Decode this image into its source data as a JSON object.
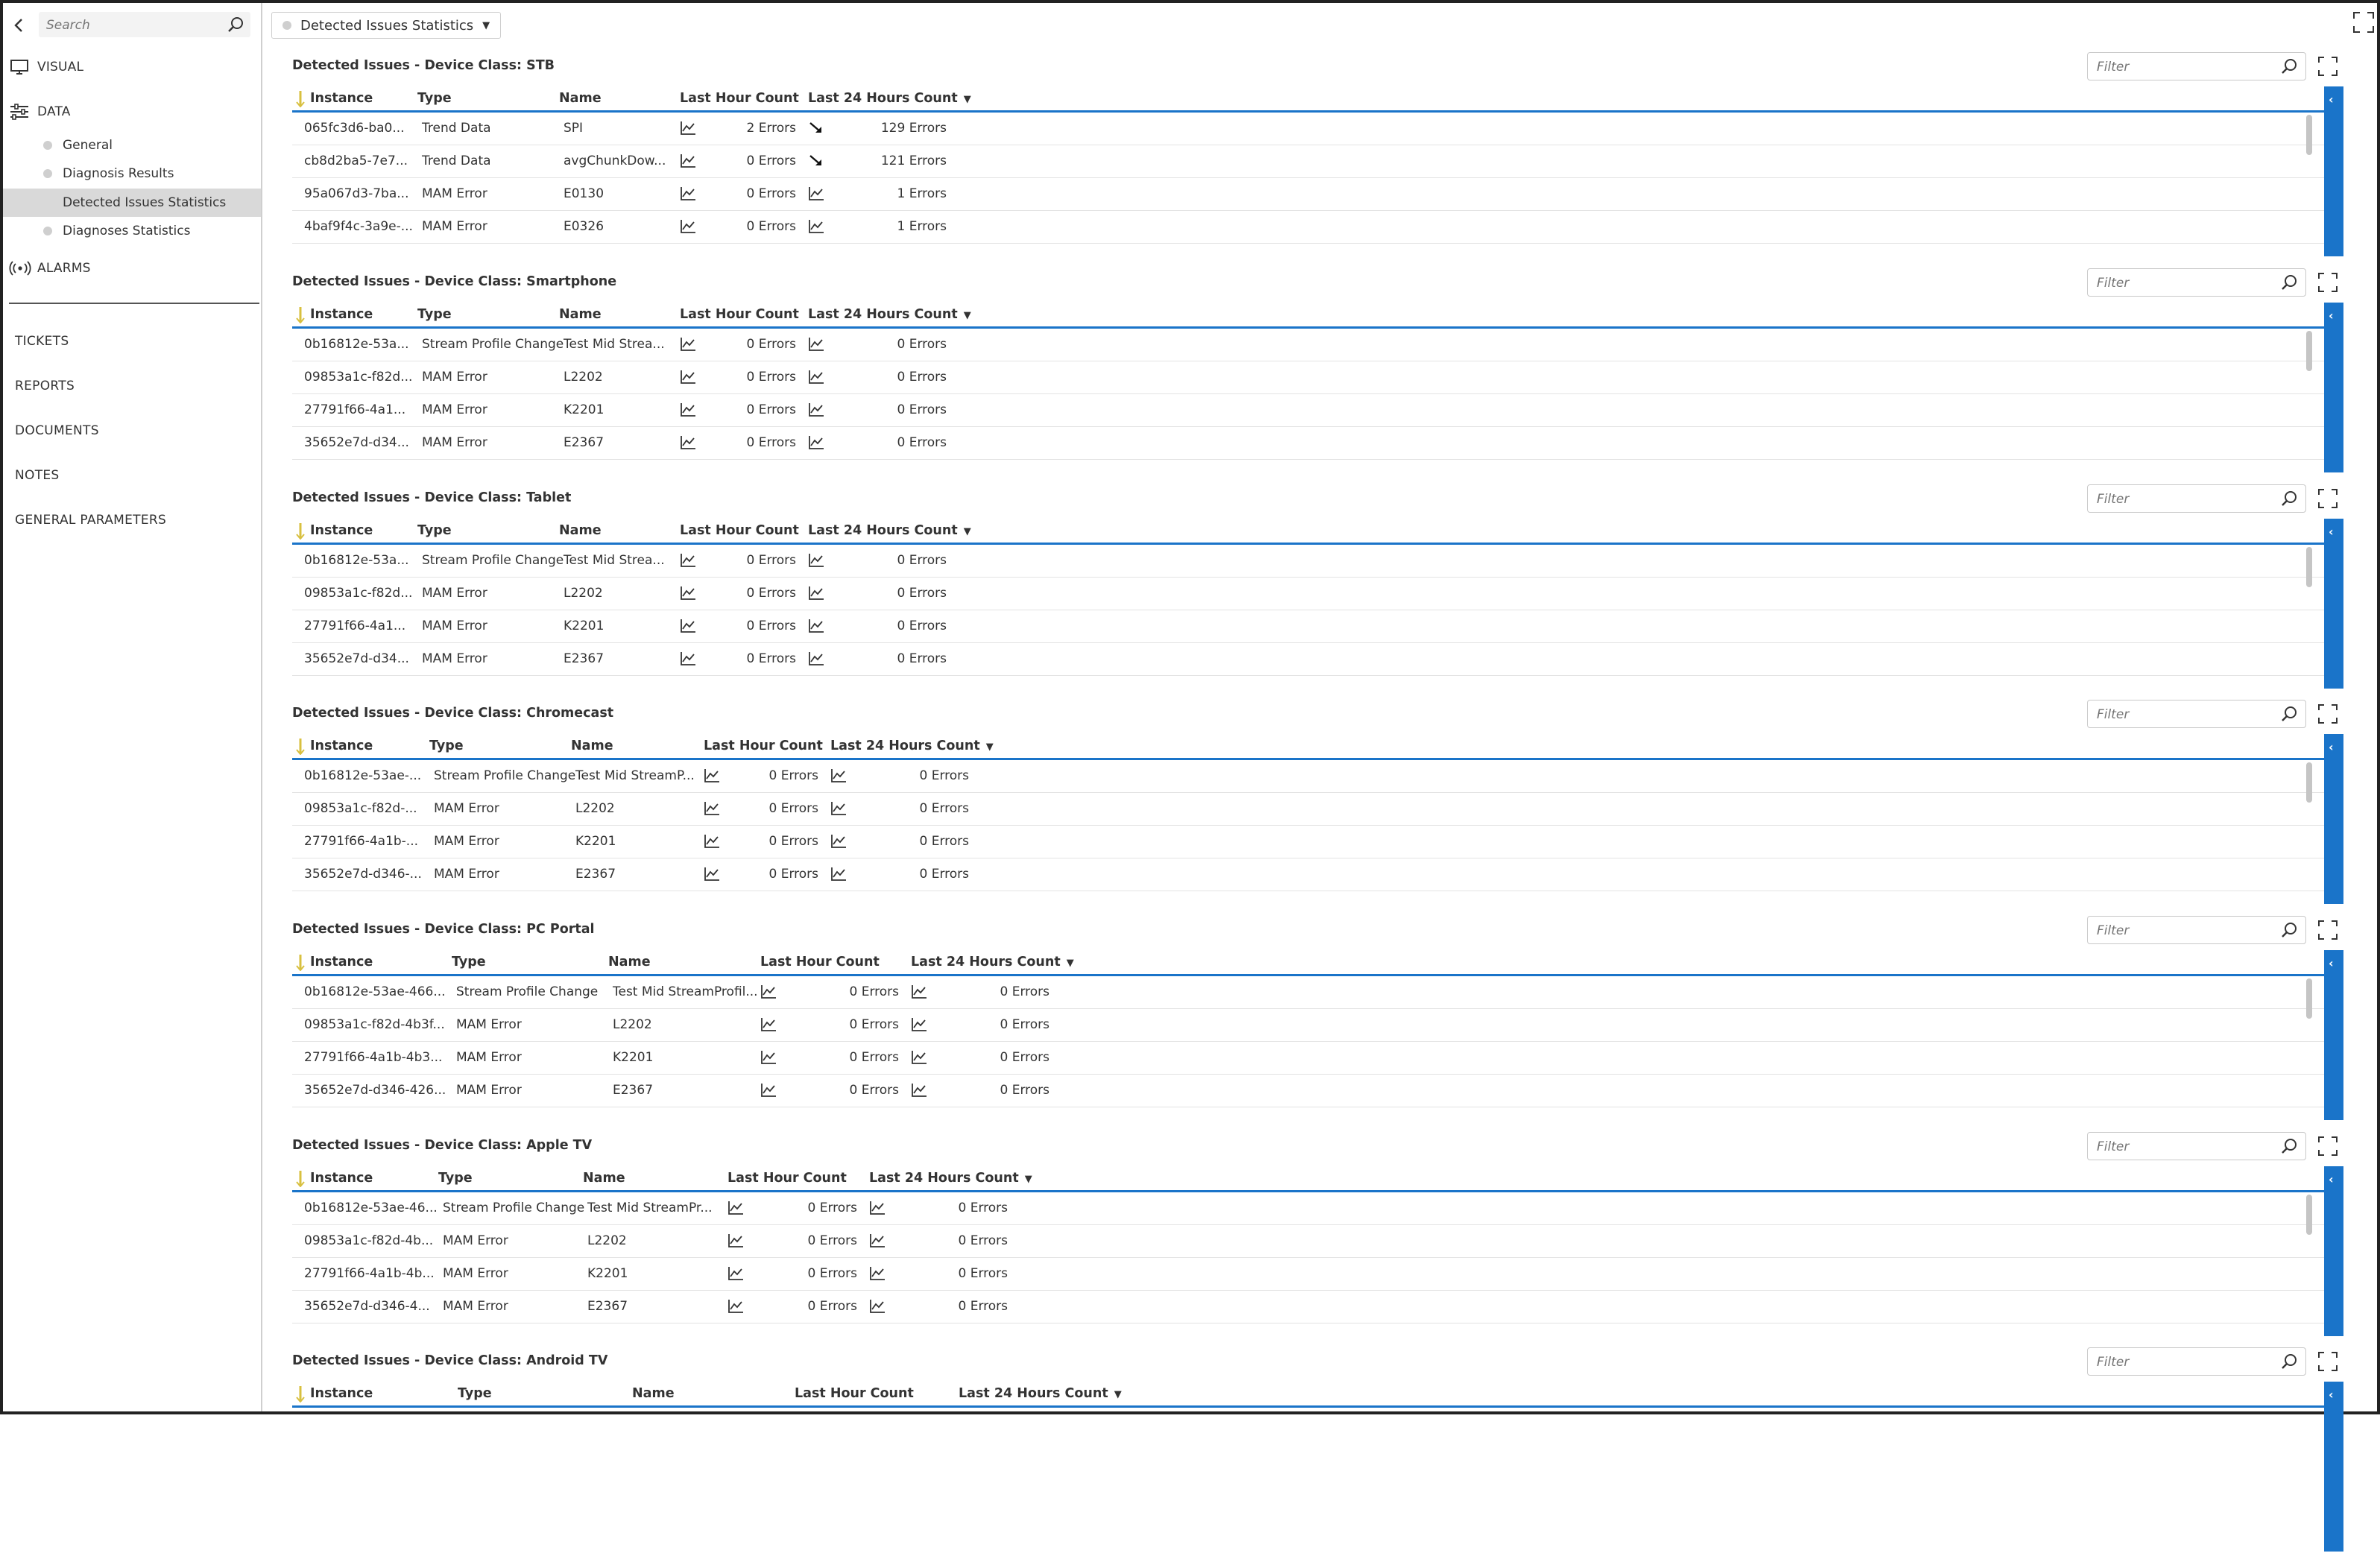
{
  "sidebar": {
    "search_placeholder": "Search",
    "nav": [
      {
        "label": "VISUAL",
        "icon": "monitor-icon"
      },
      {
        "label": "DATA",
        "icon": "sliders-icon"
      }
    ],
    "data_items": [
      {
        "label": "General",
        "dot": true,
        "active": false
      },
      {
        "label": "Diagnosis Results",
        "dot": true,
        "active": false
      },
      {
        "label": "Detected Issues Statistics",
        "dot": false,
        "active": true
      },
      {
        "label": "Diagnoses Statistics",
        "dot": true,
        "active": false
      }
    ],
    "alarms": {
      "label": "ALARMS",
      "icon": "broadcast-icon"
    },
    "links": [
      "TICKETS",
      "REPORTS",
      "DOCUMENTS",
      "NOTES",
      "GENERAL PARAMETERS"
    ]
  },
  "breadcrumb": {
    "label": "Detected Issues Statistics"
  },
  "filter_placeholder": "Filter",
  "colors": {
    "accent": "#1a74c9",
    "sort_indicator": "#d8c040"
  },
  "headers": {
    "instance": "Instance",
    "type": "Type",
    "name": "Name",
    "last_hour": "Last Hour Count",
    "last_24": "Last 24 Hours Count"
  },
  "sections": [
    {
      "title": "Detected Issues - Device Class: STB",
      "cols": [
        16,
        168,
        358,
        520,
        692
      ],
      "rows": [
        {
          "instance": "065fc3d6-ba0...",
          "type": "Trend Data",
          "name": "SPI",
          "last_hour": "2 Errors",
          "last_24": "129 Errors",
          "trend": "down"
        },
        {
          "instance": "cb8d2ba5-7e7...",
          "type": "Trend Data",
          "name": "avgChunkDow...",
          "last_hour": "0 Errors",
          "last_24": "121 Errors",
          "trend": "down"
        },
        {
          "instance": "95a067d3-7ba...",
          "type": "MAM Error",
          "name": "E0130",
          "last_hour": "0 Errors",
          "last_24": "1 Errors",
          "trend": "chart"
        },
        {
          "instance": "4baf9f4c-3a9e-...",
          "type": "MAM Error",
          "name": "E0326",
          "last_hour": "0 Errors",
          "last_24": "1 Errors",
          "trend": "chart"
        }
      ]
    },
    {
      "title": "Detected Issues - Device Class: Smartphone",
      "cols": [
        16,
        168,
        358,
        520,
        692
      ],
      "rows": [
        {
          "instance": "0b16812e-53a...",
          "type": "Stream Profile Change",
          "name": "Test Mid Strea...",
          "last_hour": "0 Errors",
          "last_24": "0 Errors",
          "trend": "chart"
        },
        {
          "instance": "09853a1c-f82d...",
          "type": "MAM Error",
          "name": "L2202",
          "last_hour": "0 Errors",
          "last_24": "0 Errors",
          "trend": "chart"
        },
        {
          "instance": "27791f66-4a1...",
          "type": "MAM Error",
          "name": "K2201",
          "last_hour": "0 Errors",
          "last_24": "0 Errors",
          "trend": "chart"
        },
        {
          "instance": "35652e7d-d34...",
          "type": "MAM Error",
          "name": "E2367",
          "last_hour": "0 Errors",
          "last_24": "0 Errors",
          "trend": "chart"
        }
      ]
    },
    {
      "title": "Detected Issues - Device Class: Tablet",
      "cols": [
        16,
        168,
        358,
        520,
        692
      ],
      "rows": [
        {
          "instance": "0b16812e-53a...",
          "type": "Stream Profile Change",
          "name": "Test Mid Strea...",
          "last_hour": "0 Errors",
          "last_24": "0 Errors",
          "trend": "chart"
        },
        {
          "instance": "09853a1c-f82d...",
          "type": "MAM Error",
          "name": "L2202",
          "last_hour": "0 Errors",
          "last_24": "0 Errors",
          "trend": "chart"
        },
        {
          "instance": "27791f66-4a1...",
          "type": "MAM Error",
          "name": "K2201",
          "last_hour": "0 Errors",
          "last_24": "0 Errors",
          "trend": "chart"
        },
        {
          "instance": "35652e7d-d34...",
          "type": "MAM Error",
          "name": "E2367",
          "last_hour": "0 Errors",
          "last_24": "0 Errors",
          "trend": "chart"
        }
      ]
    },
    {
      "title": "Detected Issues - Device Class: Chromecast",
      "cols": [
        16,
        184,
        374,
        552,
        722
      ],
      "rows": [
        {
          "instance": "0b16812e-53ae-...",
          "type": "Stream Profile Change",
          "name": "Test Mid StreamP...",
          "last_hour": "0 Errors",
          "last_24": "0 Errors",
          "trend": "chart"
        },
        {
          "instance": "09853a1c-f82d-...",
          "type": "MAM Error",
          "name": "L2202",
          "last_hour": "0 Errors",
          "last_24": "0 Errors",
          "trend": "chart"
        },
        {
          "instance": "27791f66-4a1b-...",
          "type": "MAM Error",
          "name": "K2201",
          "last_hour": "0 Errors",
          "last_24": "0 Errors",
          "trend": "chart"
        },
        {
          "instance": "35652e7d-d346-...",
          "type": "MAM Error",
          "name": "E2367",
          "last_hour": "0 Errors",
          "last_24": "0 Errors",
          "trend": "chart"
        }
      ]
    },
    {
      "title": "Detected Issues - Device Class: PC Portal",
      "cols": [
        16,
        214,
        424,
        628,
        830
      ],
      "rows": [
        {
          "instance": "0b16812e-53ae-466...",
          "type": "Stream Profile Change",
          "name": "Test Mid StreamProfil...",
          "last_hour": "0 Errors",
          "last_24": "0 Errors",
          "trend": "chart"
        },
        {
          "instance": "09853a1c-f82d-4b3f...",
          "type": "MAM Error",
          "name": "L2202",
          "last_hour": "0 Errors",
          "last_24": "0 Errors",
          "trend": "chart"
        },
        {
          "instance": "27791f66-4a1b-4b3...",
          "type": "MAM Error",
          "name": "K2201",
          "last_hour": "0 Errors",
          "last_24": "0 Errors",
          "trend": "chart"
        },
        {
          "instance": "35652e7d-d346-426...",
          "type": "MAM Error",
          "name": "E2367",
          "last_hour": "0 Errors",
          "last_24": "0 Errors",
          "trend": "chart"
        }
      ]
    },
    {
      "title": "Detected Issues - Device Class: Apple TV",
      "cols": [
        16,
        196,
        390,
        584,
        774
      ],
      "rows": [
        {
          "instance": "0b16812e-53ae-46...",
          "type": "Stream Profile Change",
          "name": "Test Mid StreamPr...",
          "last_hour": "0 Errors",
          "last_24": "0 Errors",
          "trend": "chart"
        },
        {
          "instance": "09853a1c-f82d-4b...",
          "type": "MAM Error",
          "name": "L2202",
          "last_hour": "0 Errors",
          "last_24": "0 Errors",
          "trend": "chart"
        },
        {
          "instance": "27791f66-4a1b-4b...",
          "type": "MAM Error",
          "name": "K2201",
          "last_hour": "0 Errors",
          "last_24": "0 Errors",
          "trend": "chart"
        },
        {
          "instance": "35652e7d-d346-4...",
          "type": "MAM Error",
          "name": "E2367",
          "last_hour": "0 Errors",
          "last_24": "0 Errors",
          "trend": "chart"
        }
      ]
    },
    {
      "title": "Detected Issues - Device Class: Android TV",
      "cols": [
        16,
        222,
        456,
        674,
        894
      ],
      "rows": []
    }
  ]
}
